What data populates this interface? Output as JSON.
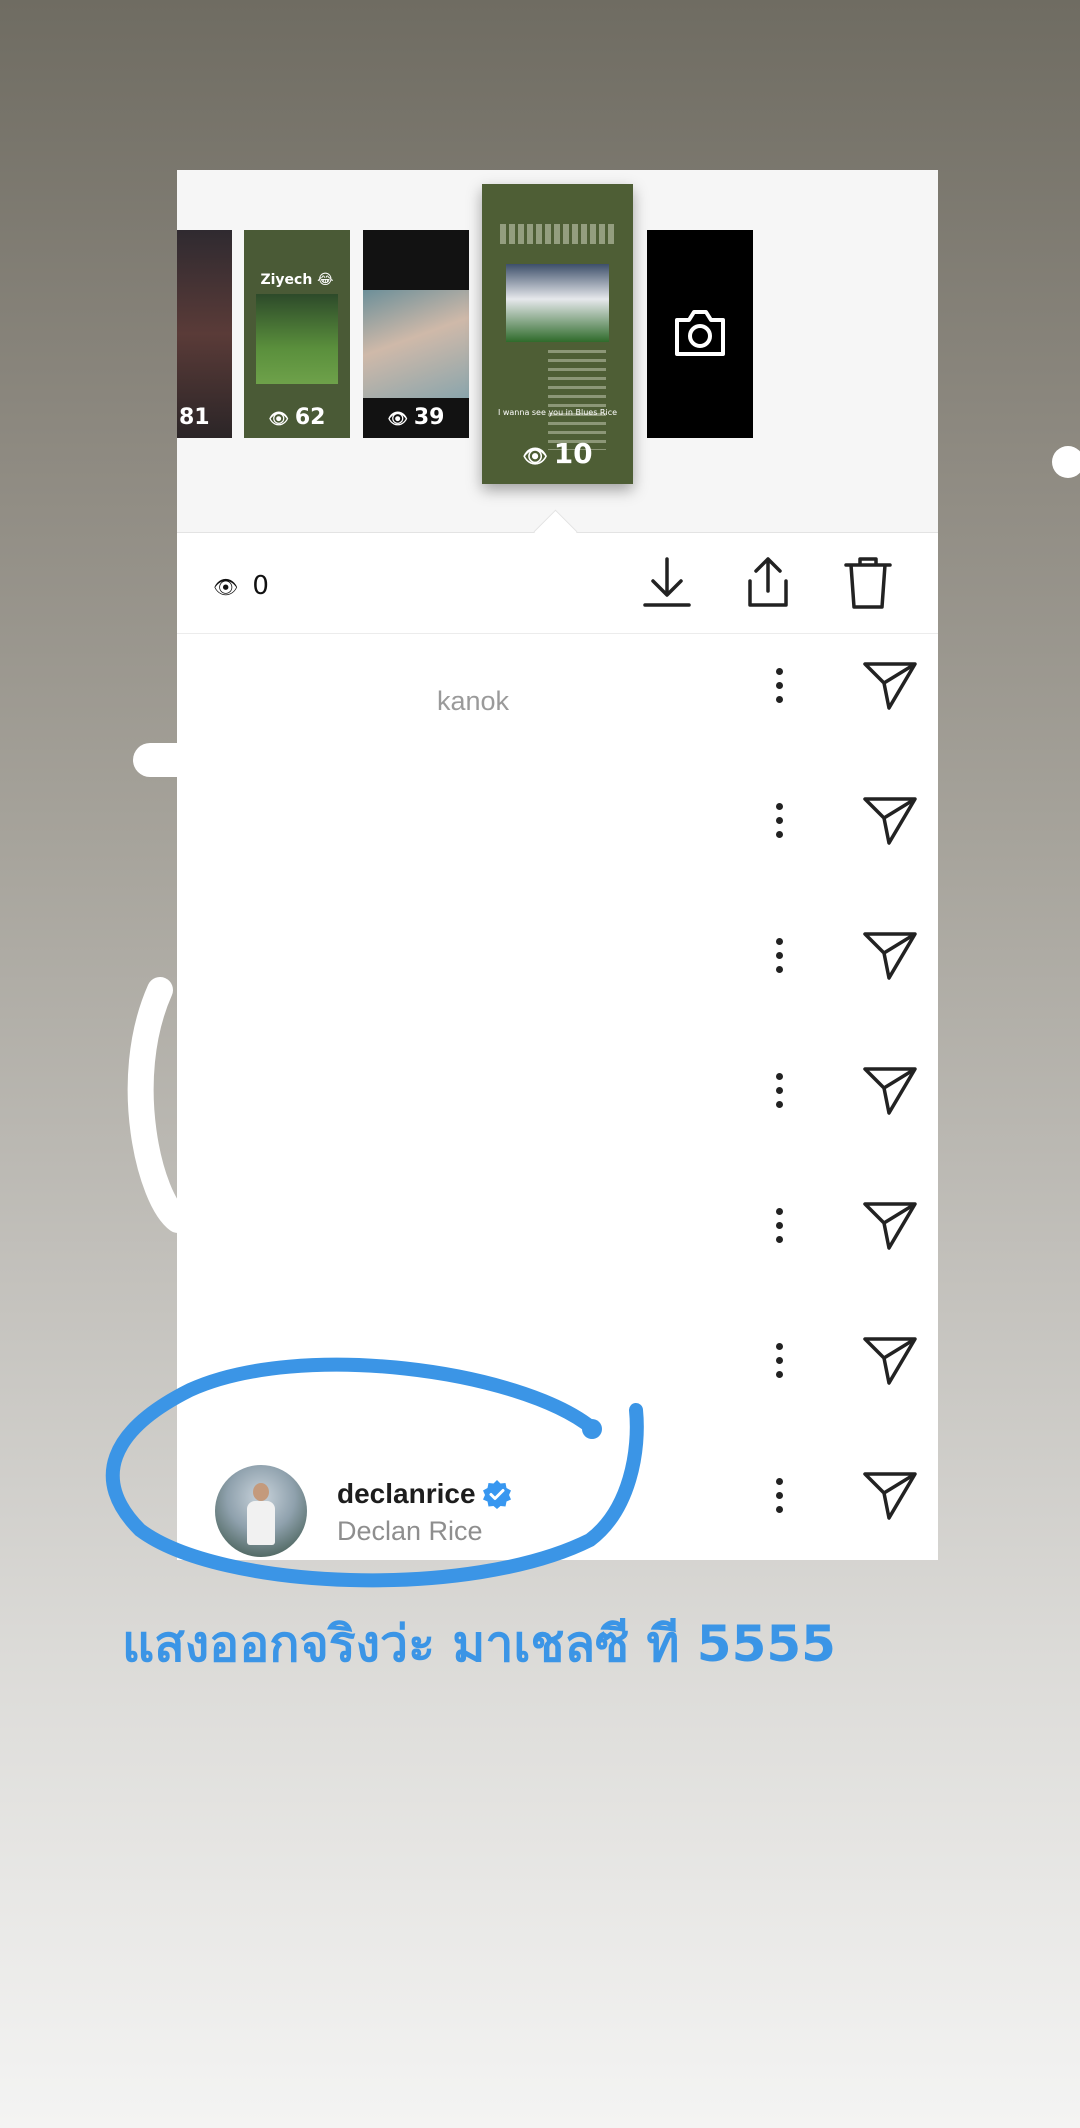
{
  "story_strip": {
    "thumbnails": [
      {
        "name": "story-1",
        "views": "81"
      },
      {
        "name": "story-2",
        "caption": "Ziyech 😂",
        "views": "62"
      },
      {
        "name": "story-3",
        "views": "39"
      },
      {
        "name": "story-4",
        "caption": "I wanna see you in Blues Rice",
        "views": "10",
        "selected": true
      },
      {
        "name": "new-story",
        "icon": "camera-icon"
      }
    ]
  },
  "toolbar": {
    "viewer_count": "0",
    "icons": [
      "eye-icon",
      "download-icon",
      "share-icon",
      "trash-icon"
    ]
  },
  "viewers": [
    {
      "fullname": "kanok",
      "faint": true
    },
    {
      "fullname": ""
    },
    {
      "fullname": ""
    },
    {
      "fullname": ""
    },
    {
      "fullname": ""
    },
    {
      "fullname": ""
    },
    {
      "username": "declanrice",
      "fullname": "Declan Rice",
      "verified": true
    }
  ],
  "annotation": {
    "caption": "แสงออกจริงว่ะ มาเชลซี ที 5555",
    "color": "#3b95e6"
  },
  "colors": {
    "verified_badge": "#3897f0",
    "annotation_blue": "#3b95e6"
  }
}
